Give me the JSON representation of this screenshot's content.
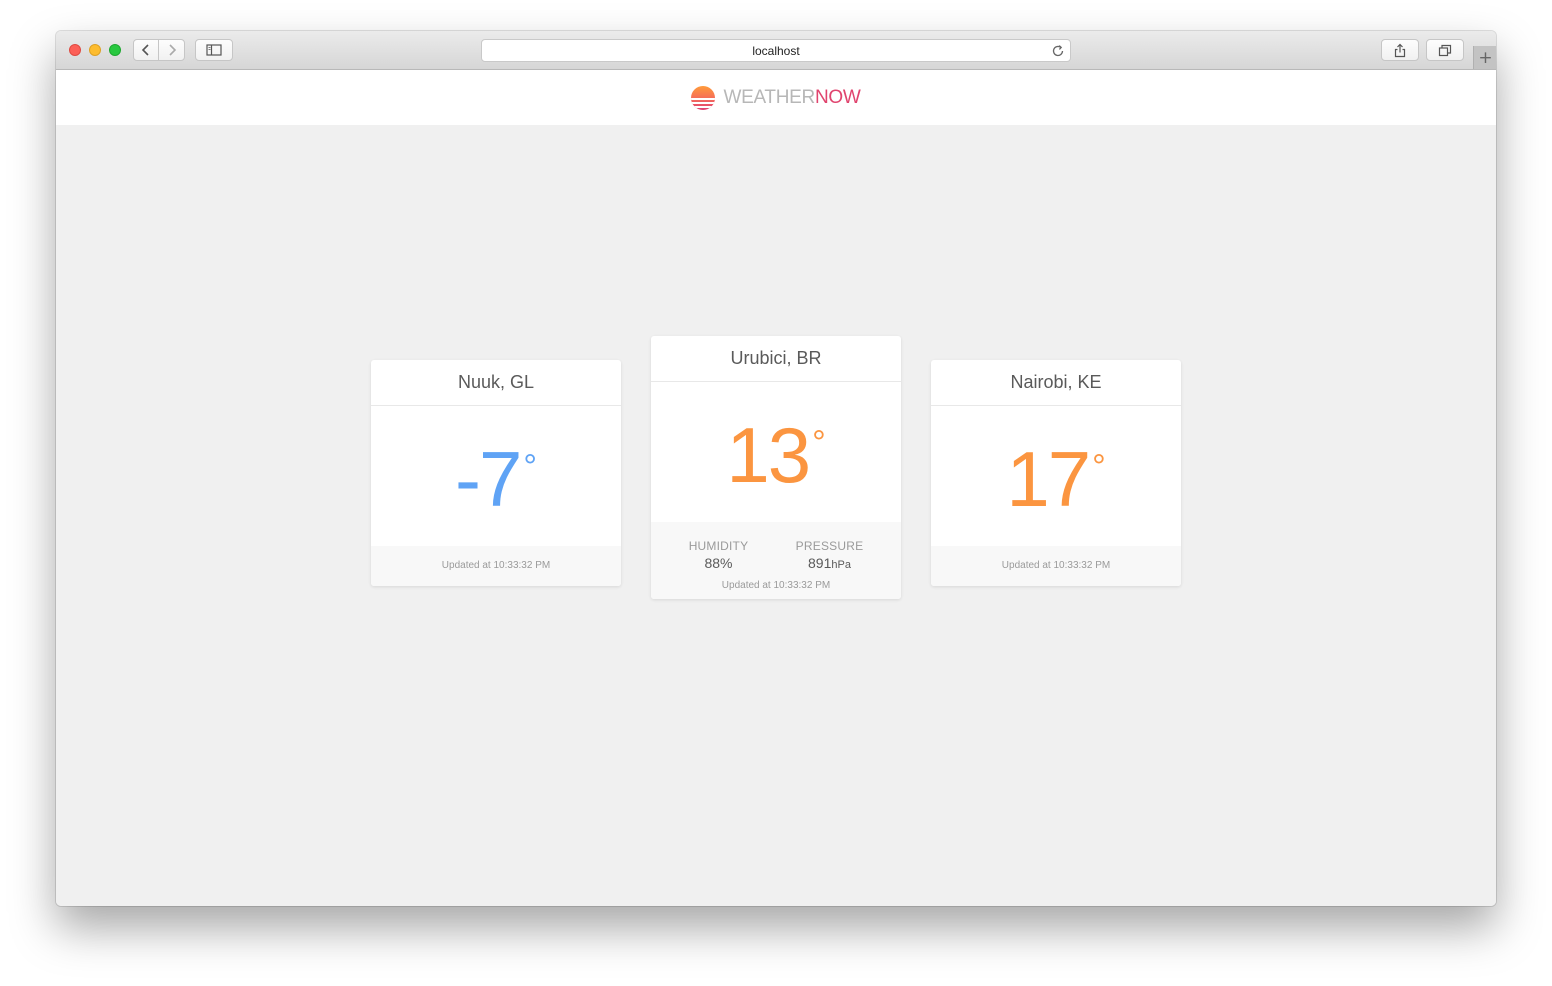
{
  "browser": {
    "url": "localhost"
  },
  "app": {
    "logo_part1": "WEATHER",
    "logo_part2": "NOW",
    "brand_color": "#e0446e"
  },
  "cards": [
    {
      "city": "Nuuk, GL",
      "temperature": "-7",
      "degree": "°",
      "temp_color": "#5fa3f5",
      "updated": "Updated at 10:33:32 PM"
    },
    {
      "city": "Urubici, BR",
      "temperature": "13",
      "degree": "°",
      "temp_color": "#fb9540",
      "humidity_label": "HUMIDITY",
      "humidity_value": "88%",
      "pressure_label": "PRESSURE",
      "pressure_value": "891",
      "pressure_unit": "hPa",
      "updated": "Updated at 10:33:32 PM"
    },
    {
      "city": "Nairobi, KE",
      "temperature": "17",
      "degree": "°",
      "temp_color": "#fb9540",
      "updated": "Updated at 10:33:32 PM"
    }
  ]
}
